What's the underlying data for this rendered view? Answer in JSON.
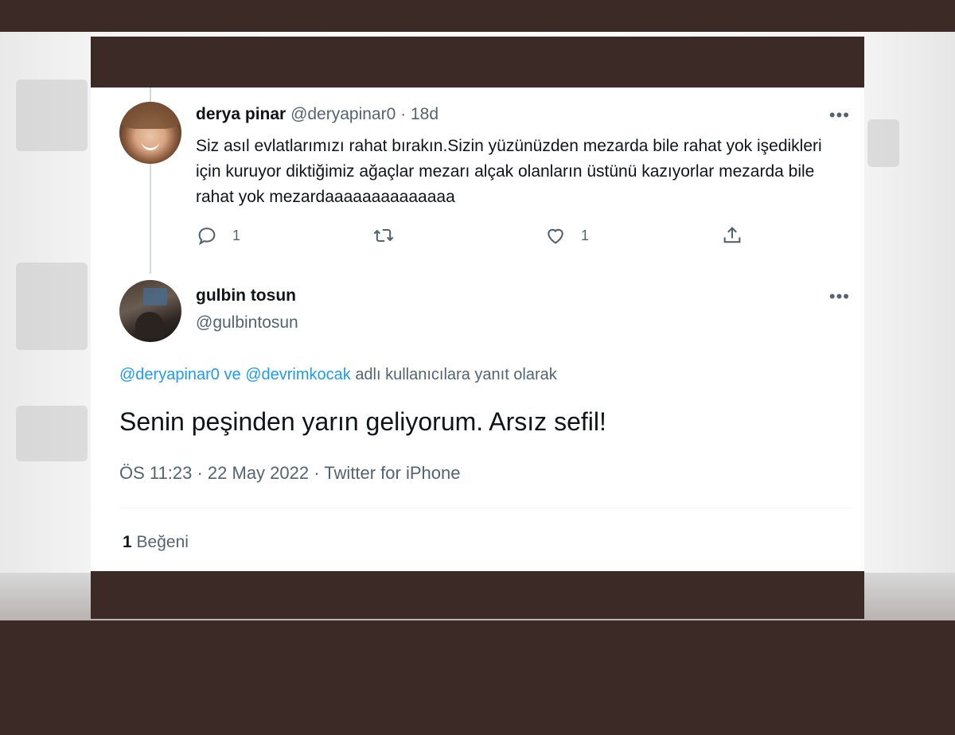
{
  "tweet1": {
    "display_name": "derya pinar",
    "handle": "@deryapinar0",
    "separator": "·",
    "time": "18d",
    "text": "Siz asıl evlatlarımızı rahat bırakın.Sizin yüzünüzden mezarda bile rahat yok işedikleri için kuruyor diktiğimiz ağaçlar mezarı alçak olanların üstünü kazıyorlar mezarda bile rahat yok mezardaaaaaaaaaaaaaa",
    "more_label": "•••",
    "reply_count": "1",
    "retweet_count": "",
    "like_count": "1",
    "icons": [
      "reply-icon",
      "retweet-icon",
      "like-icon",
      "share-icon"
    ]
  },
  "tweet2": {
    "display_name": "gulbin tosun",
    "handle": "@gulbintosun",
    "more_label": "•••",
    "reply_mention_1": "@deryapinar0",
    "reply_joiner": "ve",
    "reply_mention_2": "@devrimkocak",
    "reply_suffix": "adlı kullanıcılara yanıt olarak",
    "text": "Senin peşinden yarın geliyorum. Arsız sefil!",
    "time": "ÖS 11:23",
    "date": "22 May 2022",
    "separator": "·",
    "source": "Twitter for iPhone",
    "like_count": "1",
    "like_label": "Beğeni"
  },
  "colors": {
    "link": "#1d9bf0",
    "muted": "#536471",
    "text": "#0f1419",
    "frame": "#3b2a25"
  }
}
